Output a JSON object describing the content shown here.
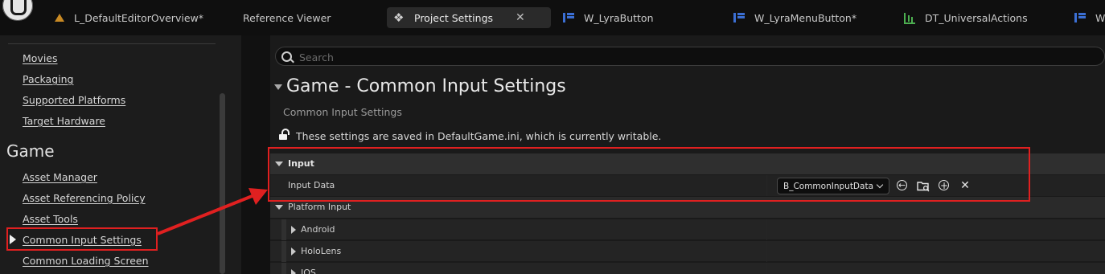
{
  "tabs": [
    {
      "label": "L_DefaultEditorOverview*",
      "icon": "level-icon"
    },
    {
      "label": "Reference Viewer",
      "icon": ""
    },
    {
      "label": "Project Settings",
      "icon": "settings-icon",
      "active": true
    },
    {
      "label": "W_LyraButton",
      "icon": "widget-blueprint-icon"
    },
    {
      "label": "W_LyraMenuButton*",
      "icon": "widget-blueprint-icon"
    },
    {
      "label": "DT_UniversalActions",
      "icon": "data-table-icon"
    },
    {
      "label": "W_",
      "icon": "widget-blueprint-icon"
    }
  ],
  "tab_close_glyph": "✕",
  "sidebar": {
    "links_top": [
      "Movies",
      "Packaging",
      "Supported Platforms",
      "Target Hardware"
    ],
    "category": "Game",
    "links_game": [
      "Asset Manager",
      "Asset Referencing Policy",
      "Asset Tools",
      "Common Input Settings",
      "Common Loading Screen"
    ],
    "selected": "Common Input Settings"
  },
  "search": {
    "placeholder": "Search",
    "value": ""
  },
  "section": {
    "title": "Game - Common Input Settings",
    "subtitle": "Common Input Settings",
    "save_message": "These settings are saved in DefaultGame.ini, which is currently writable."
  },
  "properties": {
    "input_category": "Input",
    "input_data_label": "Input Data",
    "input_data_value": "B_CommonInputData",
    "platform_category": "Platform Input",
    "platforms": [
      "Android",
      "HoloLens",
      "IOS"
    ]
  },
  "colors": {
    "highlight": "#e02020",
    "accent_widget": "#3b6fd4",
    "accent_table": "#4caf50",
    "accent_level": "#c98a24"
  }
}
